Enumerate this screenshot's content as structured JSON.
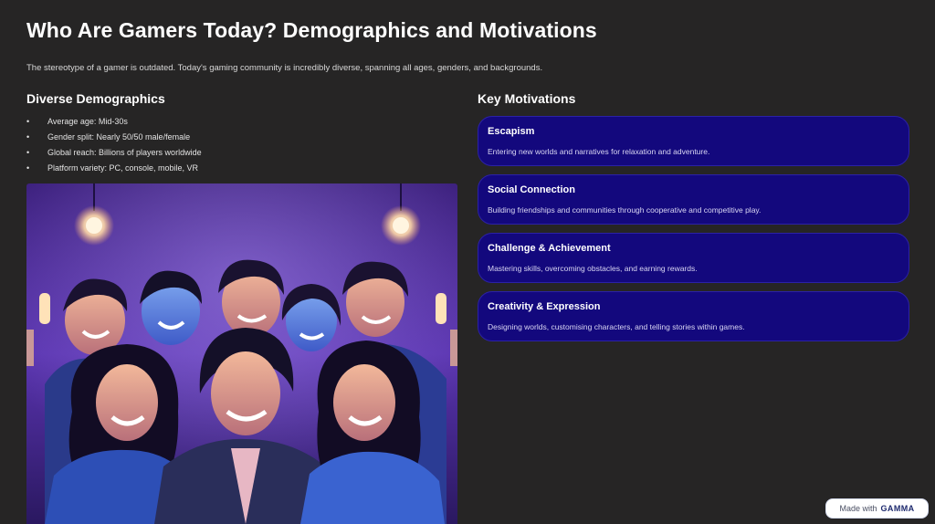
{
  "slide": {
    "title": "Who Are Gamers Today? Demographics and Motivations",
    "intro": "The stereotype of a gamer is outdated. Today's gaming community is incredibly diverse, spanning all ages, genders, and backgrounds."
  },
  "demographics": {
    "heading": "Diverse Demographics",
    "bullet_glyph": "•",
    "items": [
      "Average age: Mid-30s",
      "Gender split: Nearly 50/50 male/female",
      "Global reach: Billions of players worldwide",
      "Platform variety: PC, console, mobile, VR"
    ]
  },
  "motivations": {
    "heading": "Key Motivations",
    "cards": [
      {
        "title": "Escapism",
        "description": "Entering new worlds and narratives for relaxation and adventure."
      },
      {
        "title": "Social Connection",
        "description": "Building friendships and communities through cooperative and competitive play."
      },
      {
        "title": "Challenge & Achievement",
        "description": "Mastering skills, overcoming obstacles, and earning rewards."
      },
      {
        "title": "Creativity & Expression",
        "description": "Designing worlds, customising characters, and telling stories within games."
      }
    ]
  },
  "badge": {
    "prefix": "Made with",
    "brand": "GAMMA"
  },
  "colors": {
    "background": "#262525",
    "card_fill": "#13087d",
    "card_border": "#2b21a6",
    "photo_purple": "#6a3fc4"
  },
  "image": {
    "icon": "group-of-smiling-gamers-illustration"
  }
}
